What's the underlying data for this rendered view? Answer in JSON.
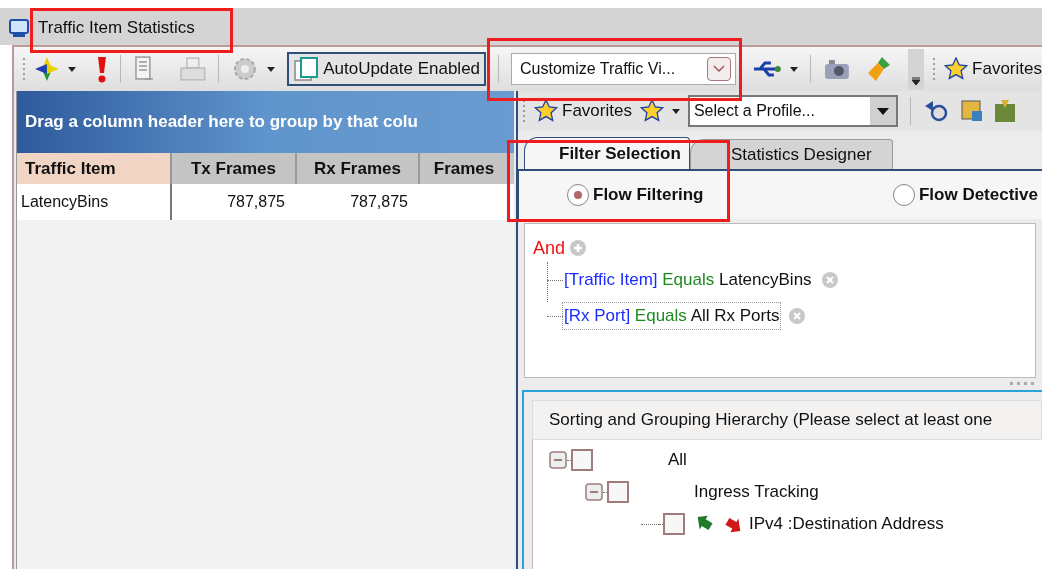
{
  "document_tab": {
    "label": "Traffic Item Statistics",
    "selected": true
  },
  "toolbar": {
    "autoupdate_button": "AutoUpdate Enabled",
    "view_dropdown": {
      "value": "Customize Traffic Vi..."
    },
    "favorites_button": "Favorites"
  },
  "grid": {
    "group_hint": "Drag a column header here to group by that colu",
    "columns": [
      {
        "label": "Traffic Item",
        "selected": true
      },
      {
        "label": "Tx Frames",
        "selected": false
      },
      {
        "label": "Rx Frames",
        "selected": false
      },
      {
        "label": "Frames",
        "selected": false
      }
    ],
    "rows": [
      {
        "cells": [
          "LatencyBins",
          "787,875",
          "787,875"
        ]
      }
    ]
  },
  "filter_panel": {
    "favorites_button": "Favorites",
    "profile_select": {
      "value": "Select a Profile..."
    },
    "tabs": [
      {
        "label": "Filter Selection",
        "selected": true
      },
      {
        "label": "Statistics Designer",
        "selected": false
      }
    ],
    "modes": [
      {
        "label": "Flow Filtering",
        "selected": true
      },
      {
        "label": "Flow Detective",
        "selected": false
      }
    ],
    "operator": "And",
    "conditions": [
      {
        "field": "[Traffic Item]",
        "op": "Equals",
        "value": "LatencyBins",
        "focused": false
      },
      {
        "field": "[Rx Port]",
        "op": "Equals",
        "value": "All Rx Ports",
        "focused": true
      }
    ]
  },
  "hierarchy": {
    "title": "Sorting and Grouping Hierarchy (Please select at least one",
    "tree": [
      {
        "label": "All",
        "checked": false,
        "expanded": true,
        "children": [
          {
            "label": "Ingress Tracking",
            "checked": false,
            "expanded": true,
            "children": [
              {
                "label": "IPv4 :Destination Address",
                "checked": false,
                "kind": "field"
              }
            ]
          }
        ]
      }
    ]
  }
}
